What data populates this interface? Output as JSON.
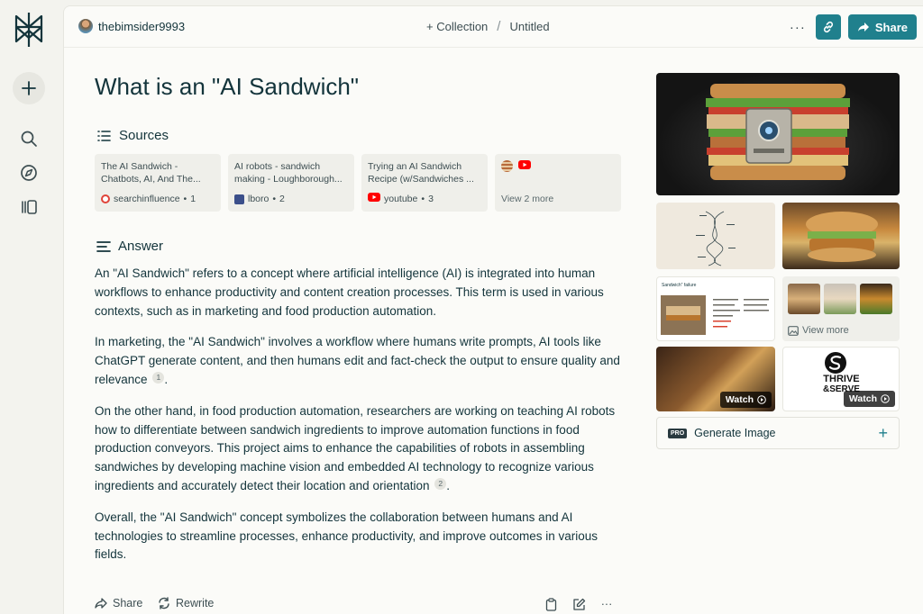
{
  "header": {
    "username": "thebimsider9993",
    "collection_label": "+ Collection",
    "separator": "/",
    "thread_name": "Untitled",
    "more": "···",
    "share_label": "Share"
  },
  "page": {
    "title": "What is an \"AI Sandwich\""
  },
  "sources": {
    "heading": "Sources",
    "items": [
      {
        "title": "The AI Sandwich - Chatbots, AI, And The...",
        "site": "searchinfluence",
        "num": "1",
        "icon": "searchinfluence-icon"
      },
      {
        "title": "AI robots - sandwich making - Loughborough...",
        "site": "lboro",
        "num": "2",
        "icon": "lboro-icon"
      },
      {
        "title": "Trying an AI Sandwich Recipe (w/Sandwiches ...",
        "site": "youtube",
        "num": "3",
        "icon": "youtube-icon"
      }
    ],
    "view_more": "View 2 more"
  },
  "answer": {
    "heading": "Answer",
    "p1": "An \"AI Sandwich\" refers to a concept where artificial intelligence (AI) is integrated into human workflows to enhance productivity and content creation processes. This term is used in various contexts, such as in marketing and food production automation.",
    "p2": "In marketing, the \"AI Sandwich\" involves a workflow where humans write prompts, AI tools like ChatGPT generate content, and then humans edit and fact-check the output to ensure quality and relevance",
    "p2_cite": "1",
    "p3": "On the other hand, in food production automation, researchers are working on teaching AI robots how to differentiate between sandwich ingredients to improve automation functions in food production conveyors. This project aims to enhance the capabilities of robots in assembling sandwiches by developing machine vision and embedded AI technology to recognize various ingredients and accurately detect their location and orientation",
    "p3_cite": "2",
    "p4": "Overall, the \"AI Sandwich\" concept symbolizes the collaboration between humans and AI technologies to streamline processes, enhance productivity, and improve outcomes in various fields.",
    "period": "."
  },
  "actions": {
    "share": "Share",
    "rewrite": "Rewrite",
    "more": "···"
  },
  "media": {
    "watch_label": "Watch",
    "view_more_label": "View more",
    "thumb3_caption": "Sandwich\" failure",
    "thrive_line1": "THRIVE",
    "thrive_line2": "&SERVE",
    "generate_image": "Generate Image",
    "pro_badge": "PRO"
  },
  "colors": {
    "accent": "#20808d",
    "text": "#13343b",
    "background": "#f3f3ee"
  }
}
